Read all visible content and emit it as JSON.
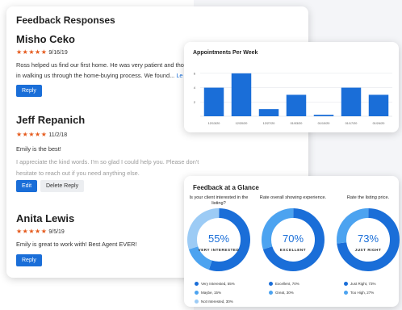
{
  "feedback": {
    "title": "Feedback Responses",
    "reviews": [
      {
        "name": "Misho Ceko",
        "stars": "★★★★★",
        "date": "9/16/19",
        "text_line1": "Ross helped us find our first home. He was very patient and tho",
        "text_line2": "in walking us through the home-buying process. We found...",
        "more": "Le",
        "reply_label": "Reply"
      },
      {
        "name": "Jeff Repanich",
        "stars": "★★★★★",
        "date": "11/2/18",
        "text": "Emily is the best!",
        "agent_reply": "I appreciate the kind words. I'm so glad I could help you. Please don't hesitate to reach out if you need anything else.",
        "edit_label": "Edit",
        "delete_label": "Delete Reply"
      },
      {
        "name": "Anita Lewis",
        "stars": "★★★★★",
        "date": "9/5/19",
        "text": "Emily is great to work with! Best Agent EVER!",
        "reply_label": "Reply"
      }
    ]
  },
  "appointments": {
    "title": "Appointments Per Week",
    "chart_data": {
      "type": "bar",
      "title": "Appointments Per Week",
      "categories": [
        "12/13/20",
        "12/20/20",
        "12/27/20",
        "01/03/20",
        "01/10/20",
        "01/17/20",
        "01/24/20"
      ],
      "values": [
        4,
        6,
        1,
        3,
        0.2,
        4,
        3
      ],
      "y_ticks": [
        "2",
        "4",
        "6"
      ],
      "ylim": [
        0,
        7
      ],
      "color": "#1a6ed8",
      "grid": true
    }
  },
  "glance": {
    "title": "Feedback at a Glance",
    "items": [
      {
        "question": "Is your client interested in the listing?",
        "percent": "55%",
        "label": "VERY INTERESTED",
        "segments": [
          55,
          15,
          30
        ],
        "colors": [
          "#1a6ed8",
          "#4ca3f0",
          "#9ccbf5"
        ],
        "legend": [
          "Very Interested, 55%",
          "Maybe, 15%",
          "Not Interested, 30%"
        ]
      },
      {
        "question": "Rate overall showing experience.",
        "percent": "70%",
        "label": "EXCELLENT",
        "segments": [
          70,
          30
        ],
        "colors": [
          "#1a6ed8",
          "#4ca3f0"
        ],
        "legend": [
          "Excellent, 70%",
          "Great, 30%"
        ]
      },
      {
        "question": "Rate the listing price.",
        "percent": "73%",
        "label": "JUST RIGHT",
        "segments": [
          73,
          27
        ],
        "colors": [
          "#1a6ed8",
          "#4ca3f0"
        ],
        "legend": [
          "Just Right, 73%",
          "Too High, 27%"
        ]
      }
    ]
  }
}
